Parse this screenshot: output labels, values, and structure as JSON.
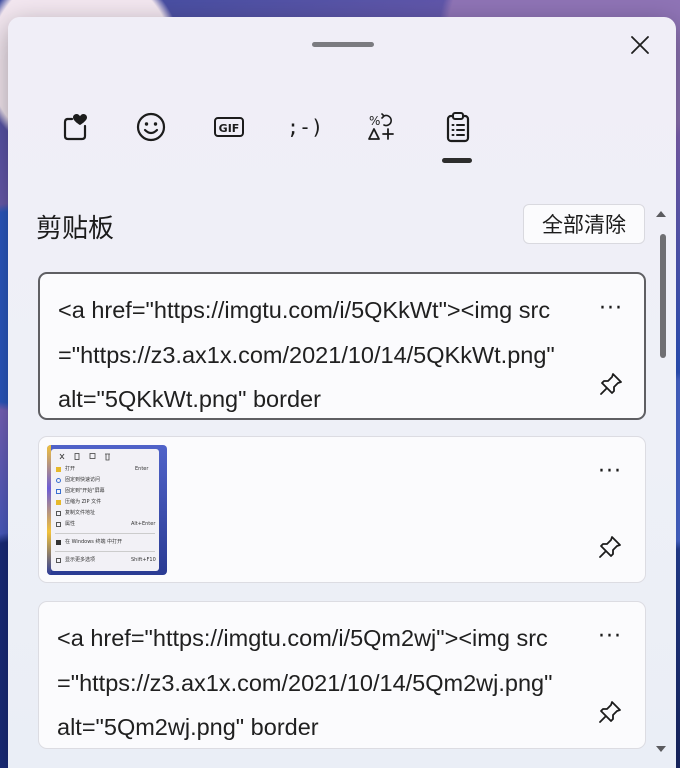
{
  "tabs": [
    {
      "name": "favorites-tab-icon"
    },
    {
      "name": "emoji-tab-icon"
    },
    {
      "name": "gif-tab-icon",
      "label": "GIF"
    },
    {
      "name": "kaomoji-tab-icon",
      "label": ";-)"
    },
    {
      "name": "symbols-tab-icon"
    },
    {
      "name": "clipboard-tab-icon",
      "selected": true
    }
  ],
  "header": {
    "title": "剪贴板",
    "clear_all": "全部清除"
  },
  "items": [
    {
      "type": "text",
      "selected": true,
      "text": "<a href=\"https://imgtu.com/i/5QKkWt\"><img src=\"https://z3.ax1x.com/2021/10/14/5QKkWt.png\" alt=\"5QKkWt.png\" border",
      "more": "···"
    },
    {
      "type": "image",
      "more": "···",
      "thumb_rows": [
        "打开",
        "固定到快速访问",
        "固定到\"开始\"屏幕",
        "压缩为 ZIP 文件",
        "复制文件地址",
        "属性",
        "在 Windows 终端 中打开",
        "显示更多选项"
      ],
      "thumb_shortcuts": [
        "Enter",
        "",
        "",
        "",
        "",
        "Alt+Enter",
        "",
        "Shift+F10"
      ]
    },
    {
      "type": "text",
      "selected": false,
      "text": "<a href=\"https://imgtu.com/i/5Qm2wj\"><img src=\"https://z3.ax1x.com/2021/10/14/5Qm2wj.png\" alt=\"5Qm2wj.png\" border",
      "more": "···"
    }
  ],
  "colors": {
    "panel_bg": "#f0eef7",
    "text": "#1b1b1b",
    "selected_border": "#5f5f63",
    "scroll_thumb": "#6f6f73"
  }
}
